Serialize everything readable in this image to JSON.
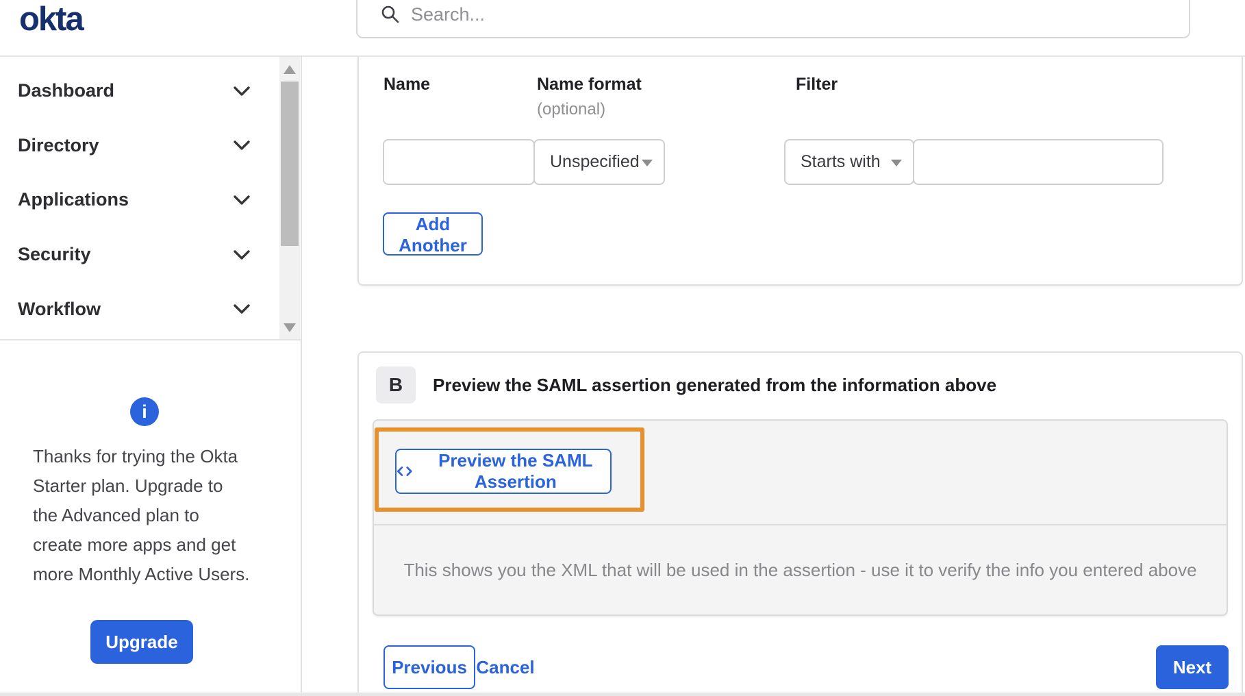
{
  "header": {
    "logo_text": "okta",
    "search_placeholder": "Search..."
  },
  "sidebar": {
    "items": [
      {
        "label": "Dashboard"
      },
      {
        "label": "Directory"
      },
      {
        "label": "Applications"
      },
      {
        "label": "Security"
      },
      {
        "label": "Workflow"
      }
    ],
    "trial": {
      "lines": [
        "Thanks for trying the Okta",
        "Starter plan. Upgrade to",
        "the Advanced plan to",
        "create more apps and get",
        "more Monthly Active Users."
      ],
      "upgrade_label": "Upgrade"
    }
  },
  "attribute_form": {
    "columns": [
      {
        "label": "Name"
      },
      {
        "label": "Name format",
        "hint": "(optional)"
      },
      {
        "label": "Filter"
      }
    ],
    "name_value": "",
    "name_format_selected": "Unspecified",
    "filter_operator_selected": "Starts with",
    "filter_value": "",
    "add_another_label": "Add Another"
  },
  "preview_section": {
    "step_badge": "B",
    "heading": "Preview the SAML assertion generated from the information above",
    "preview_button_label": "Preview the SAML Assertion",
    "helper_text": "This shows you the XML that will be used in the assertion - use it to verify the info you entered above"
  },
  "wizard_footer": {
    "previous_label": "Previous",
    "cancel_label": "Cancel",
    "next_label": "Next"
  },
  "colors": {
    "accent_blue": "#2a63dc",
    "logo_navy": "#16306e",
    "annotation_orange": "#e8912c",
    "step_badge_bg": "#ececee",
    "panel_bg": "#f4f4f5"
  }
}
